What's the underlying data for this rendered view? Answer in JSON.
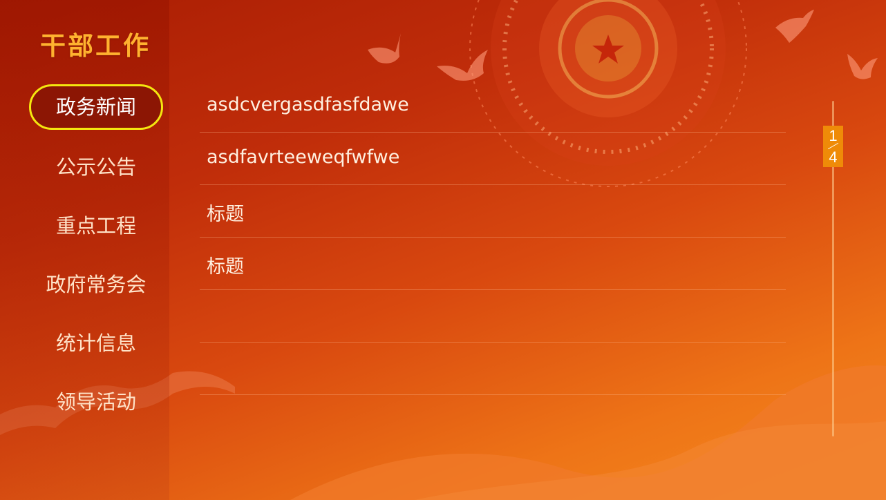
{
  "header": {
    "title": "干部工作"
  },
  "sidebar": {
    "items": [
      {
        "label": "政务新闻",
        "active": true
      },
      {
        "label": "公示公告",
        "active": false
      },
      {
        "label": "重点工程",
        "active": false
      },
      {
        "label": "政府常务会",
        "active": false
      },
      {
        "label": "统计信息",
        "active": false
      },
      {
        "label": "领导活动",
        "active": false
      }
    ]
  },
  "list": {
    "rows": [
      {
        "title": "asdcvergasdfasfdawe"
      },
      {
        "title": "asdfavrteeweqfwfwe"
      },
      {
        "title": "标题"
      },
      {
        "title": "标题"
      },
      {
        "title": ""
      },
      {
        "title": ""
      }
    ]
  },
  "pagination": {
    "current": "1",
    "total": "4"
  },
  "colors": {
    "accent": "#ffb22f",
    "active_border": "#f4e70f",
    "active_bg": "#8c1604",
    "badge": "#ef8b08"
  },
  "icons": {
    "emblem": "national-emblem-icon",
    "doves": "dove-icon"
  }
}
